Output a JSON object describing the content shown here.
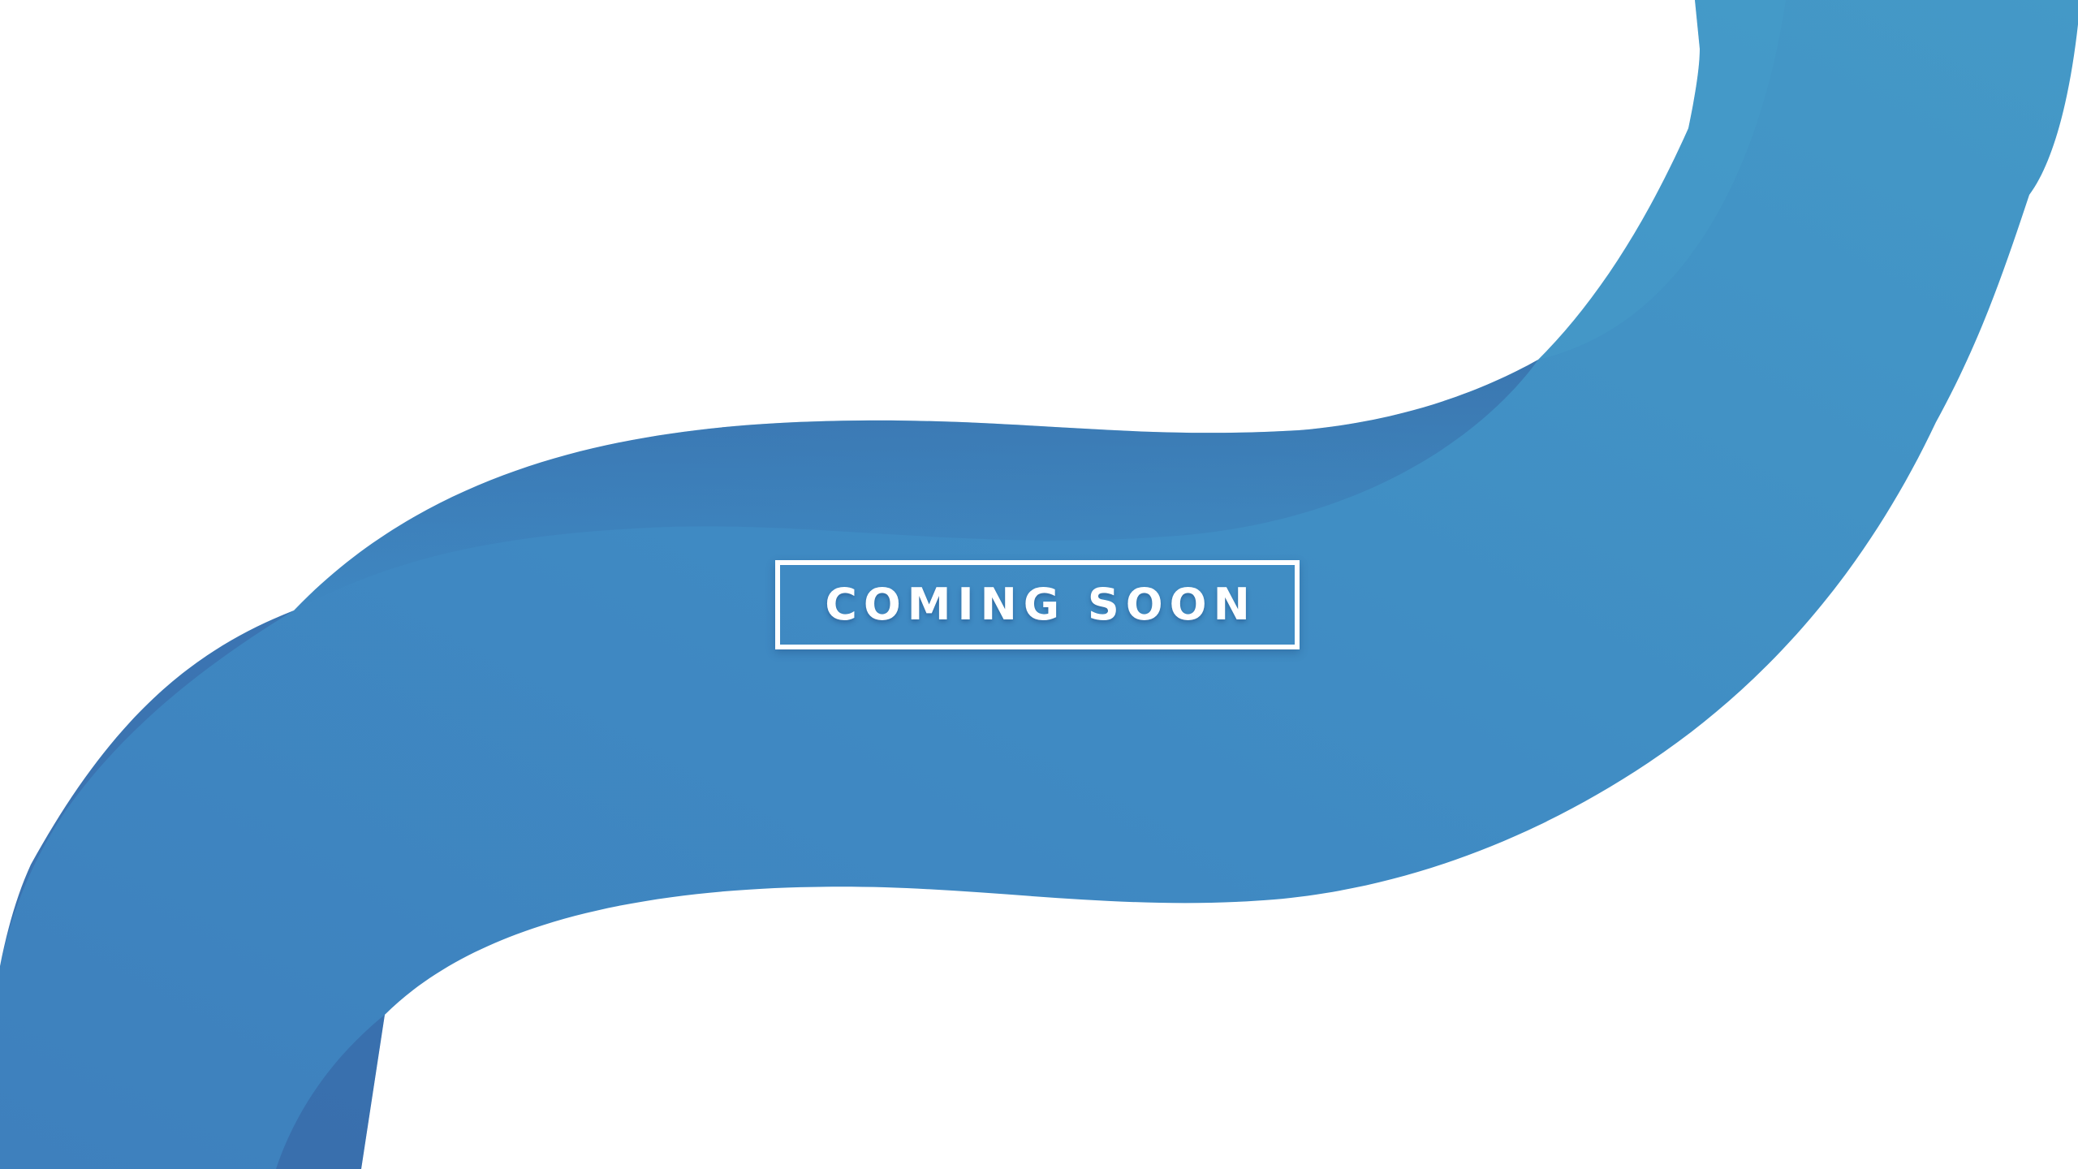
{
  "hero": {
    "label": "COMING SOON"
  },
  "colors": {
    "background": "#ffffff",
    "ribbon_light": "#4397c6",
    "ribbon_mid": "#3e87c0",
    "ribbon_dark": "#3a6aac",
    "text": "#ffffff"
  },
  "icons": {
    "ribbon": "wave-ribbon-graphic"
  }
}
